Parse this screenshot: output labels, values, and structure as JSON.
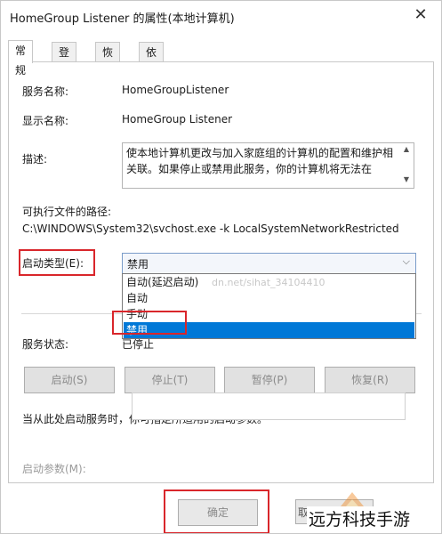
{
  "window": {
    "title": "HomeGroup Listener 的属性(本地计算机)",
    "close_glyph": "✕"
  },
  "tabs": [
    {
      "label": "常规",
      "active": true
    },
    {
      "label": "登录",
      "active": false
    },
    {
      "label": "恢复",
      "active": false
    },
    {
      "label": "依存关系",
      "active": false
    }
  ],
  "general": {
    "service_name_label": "服务名称:",
    "service_name": "HomeGroupListener",
    "display_name_label": "显示名称:",
    "display_name": "HomeGroup Listener",
    "description_label": "描述:",
    "description": "使本地计算机更改与加入家庭组的计算机的配置和维护相关联。如果停止或禁用此服务，你的计算机将无法在",
    "exe_path_label": "可执行文件的路径:",
    "exe_path": "C:\\WINDOWS\\System32\\svchost.exe -k LocalSystemNetworkRestricted",
    "startup_type_label": "启动类型(E):",
    "startup_type_value": "禁用",
    "startup_options": [
      "自动(延迟启动)",
      "自动",
      "手动",
      "禁用"
    ],
    "selected_option_index": 3,
    "service_status_label": "服务状态:",
    "service_status": "已停止",
    "hint": "当从此处启动服务时，你可指定所适用的启动参数。",
    "start_params_label": "启动参数(M):"
  },
  "service_buttons": {
    "start": "启动(S)",
    "stop": "停止(T)",
    "pause": "暂停(P)",
    "resume": "恢复(R)"
  },
  "footer": {
    "ok": "确定",
    "cancel_partial": "取"
  },
  "overlay": {
    "watermark": "dn.net/sihat_34104410",
    "brand": "远方科技手游"
  },
  "colors": {
    "selection": "#0078d7",
    "highlight_box": "#d9262b"
  },
  "icons": {
    "close": "close-icon",
    "dropdown": "chevron-down-icon",
    "scroll_up": "scroll-up-icon",
    "scroll_down": "scroll-down-icon"
  }
}
